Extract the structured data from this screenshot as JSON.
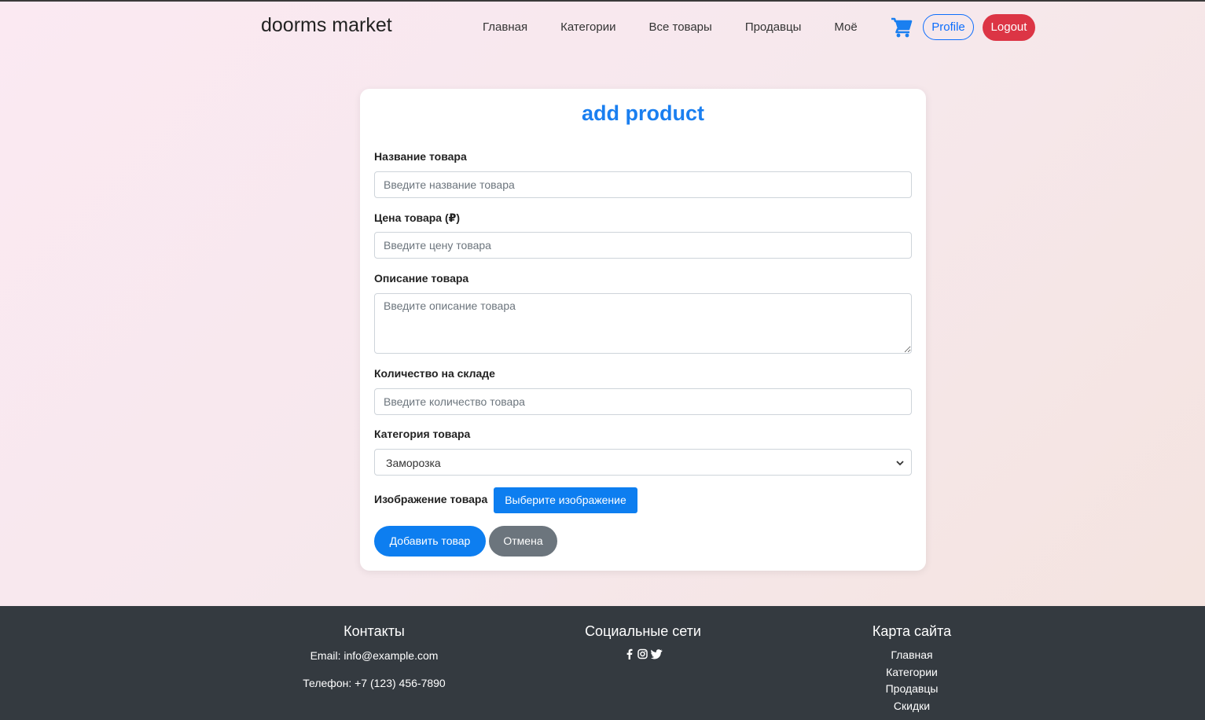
{
  "header": {
    "brand": "doorms market",
    "nav": [
      "Главная",
      "Категории",
      "Все товары",
      "Продавцы",
      "Моё"
    ],
    "profile_label": "Profile",
    "logout_label": "Logout",
    "cart_icon": "cart-icon"
  },
  "form": {
    "title": "add product",
    "name_label": "Название товара",
    "name_placeholder": "Введите название товара",
    "price_label": "Цена товара (₽)",
    "price_placeholder": "Введите цену товара",
    "description_label": "Описание товара",
    "description_placeholder": "Введите описание товара",
    "stock_label": "Количество на складе",
    "stock_placeholder": "Введите количество товара",
    "category_label": "Категория товара",
    "category_selected": "Заморозка",
    "image_label": "Изображение товара",
    "image_button": "Выберите изображение",
    "submit_button": "Добавить товар",
    "cancel_button": "Отмена"
  },
  "footer": {
    "contacts_title": "Контакты",
    "email": "Email: info@example.com",
    "phone": "Телефон: +7 (123) 456-7890",
    "social_title": "Социальные сети",
    "social_icons": [
      "facebook-icon",
      "instagram-icon",
      "twitter-icon"
    ],
    "sitemap_title": "Карта сайта",
    "sitemap": [
      "Главная",
      "Категории",
      "Продавцы",
      "Скидки"
    ]
  },
  "colors": {
    "primary": "#0d7ef0",
    "danger": "#dc3545",
    "secondary": "#6c757d",
    "footer_bg": "#343a40",
    "title": "#1a7ff0"
  }
}
